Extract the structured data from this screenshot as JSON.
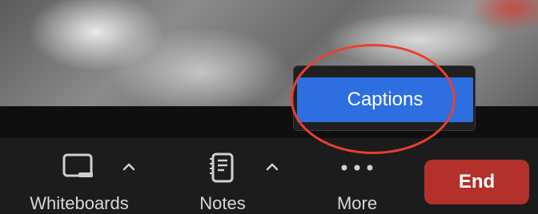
{
  "popup": {
    "captions_label": "Captions"
  },
  "toolbar": {
    "whiteboards_label": "Whiteboards",
    "notes_label": "Notes",
    "more_label": "More",
    "end_label": "End"
  },
  "colors": {
    "accent_blue": "#2d6fe0",
    "end_red": "#b3302b",
    "annotation_red": "#e8402f"
  },
  "icons": [
    "whiteboard-icon",
    "notes-icon",
    "more-icon",
    "caret-up-icon"
  ]
}
